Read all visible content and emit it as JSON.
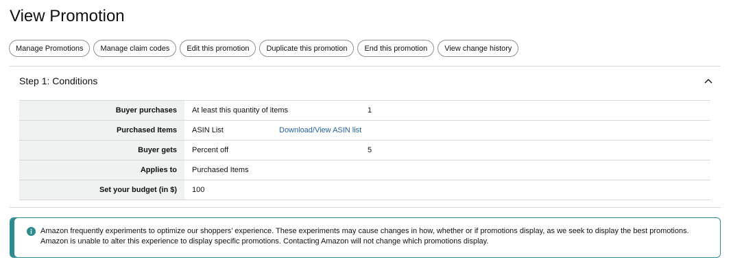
{
  "page": {
    "title": "View Promotion"
  },
  "toolbar": {
    "buttons": [
      "Manage Promotions",
      "Manage claim codes",
      "Edit this promotion",
      "Duplicate this promotion",
      "End this promotion",
      "View change history"
    ]
  },
  "section": {
    "title": "Step 1: Conditions",
    "toggle_icon": "chevron-up-icon",
    "rows": [
      {
        "label": "Buyer purchases",
        "value": "At least this quantity of items",
        "extra": "1"
      },
      {
        "label": "Purchased Items",
        "value": "ASIN List",
        "link": "Download/View ASIN list"
      },
      {
        "label": "Buyer gets",
        "value": "Percent off",
        "extra": "5"
      },
      {
        "label": "Applies to",
        "value": "Purchased Items"
      },
      {
        "label": "Set your budget (in $)",
        "value": "100"
      }
    ]
  },
  "notice": {
    "icon": "info-icon",
    "text": "Amazon frequently experiments to optimize our shoppers’ experience. These experiments may cause changes in how, whether or if promotions display, as we seek to display the best promotions. Amazon is unable to alter this experience to display specific promotions. Contacting Amazon will not change which promotions display.",
    "accent_color": "#2d8a8f"
  },
  "colors": {
    "link": "#2162a1",
    "label_background": "#f0f2f2",
    "border": "#d5d9d9"
  }
}
